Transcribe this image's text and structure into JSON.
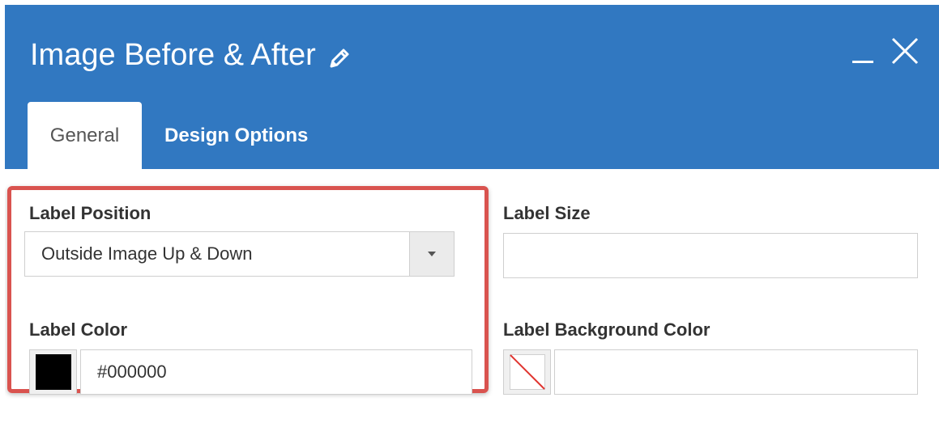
{
  "dialog": {
    "title": "Image Before & After",
    "colors": {
      "header_bg": "#3178c1",
      "highlight_border": "#d9534f"
    },
    "icons": {
      "edit": "pencil-icon",
      "minimize": "minimize-icon",
      "close": "close-icon"
    }
  },
  "tabs": [
    {
      "label": "General",
      "active": true
    },
    {
      "label": "Design Options",
      "active": false
    }
  ],
  "fields": {
    "label_position": {
      "label": "Label Position",
      "value": "Outside Image Up & Down"
    },
    "label_size": {
      "label": "Label Size",
      "value": ""
    },
    "label_color": {
      "label": "Label Color",
      "value": "#000000",
      "swatch_color": "#000000"
    },
    "label_background_color": {
      "label": "Label Background Color",
      "value": "",
      "swatch": "none"
    }
  }
}
